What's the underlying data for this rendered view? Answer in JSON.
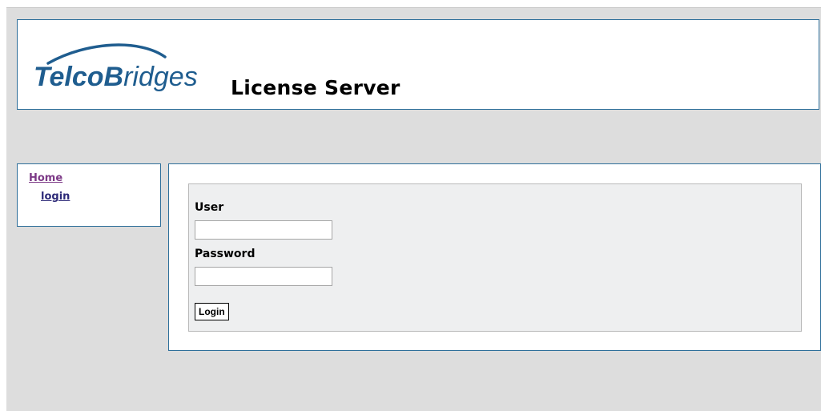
{
  "logo": {
    "brand_part1": "Telco",
    "brand_part2": "B",
    "brand_part3": "ridges"
  },
  "header": {
    "title": "License Server"
  },
  "nav": {
    "home_label": "Home",
    "login_label": "login"
  },
  "form": {
    "user_label": "User",
    "user_value": "",
    "password_label": "Password",
    "password_value": "",
    "login_button": "Login"
  },
  "colors": {
    "page_background": "#dddddd",
    "border_blue": "#2e6f9a",
    "logo_blue": "#1f5d8f",
    "link_home": "#7d3a87",
    "link_login": "#2d2a78",
    "form_panel": "#eeeff0"
  }
}
